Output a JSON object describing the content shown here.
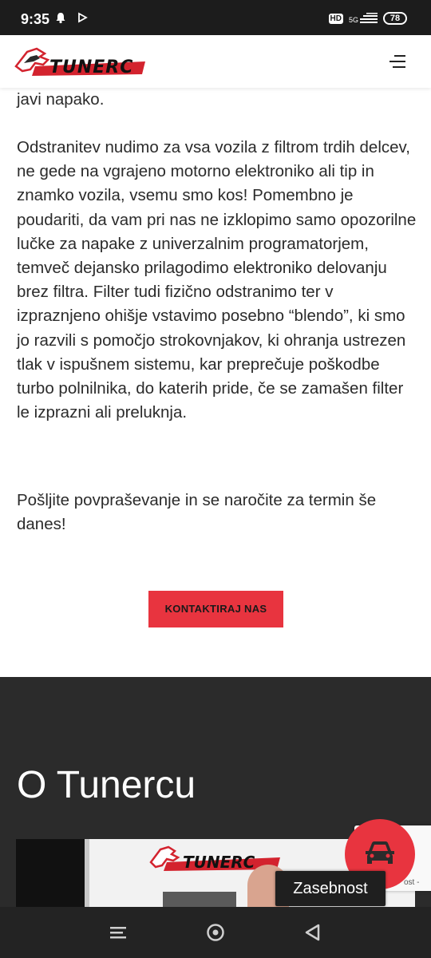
{
  "status_bar": {
    "time": "9:35",
    "hd": "HD",
    "network": "5G",
    "battery": "78"
  },
  "header": {
    "logo_text": "TUNERC"
  },
  "content": {
    "para_top": "javi napako.",
    "para_main": "Odstranitev nudimo za vsa vozila z filtrom trdih delcev, ne gede na vgrajeno motorno elektroniko ali tip in znamko vozila, vsemu smo kos! Pomembno je poudariti, da vam pri nas ne izklopimo samo opozorilne lučke za napake z univerzalnim programatorjem, temveč dejansko prilagodimo elektroniko delovanju brez filtra. Filter tudi fizično odstranimo ter v izpraznjeno ohišje vstavimo posebno “blendo”, ki smo jo razvili s pomočjo strokovnjakov, ki ohranja ustrezen tlak v ispušnem sistemu, kar preprečuje poškodbe turbo polnilnika, do katerih pride, če se zamašen filter le izprazni ali preluknja.",
    "para_cta": "Pošljite povpraševanje in se naročite za termin še danes!",
    "contact_button": "KONTAKTIRAJ NAS"
  },
  "about": {
    "title": "O Tunercu"
  },
  "overlay": {
    "privacy_tooltip": "Zasebnost",
    "recaptcha_partial": "ost -"
  },
  "colors": {
    "accent": "#e8343f",
    "dark_section": "#2b2b2b"
  }
}
